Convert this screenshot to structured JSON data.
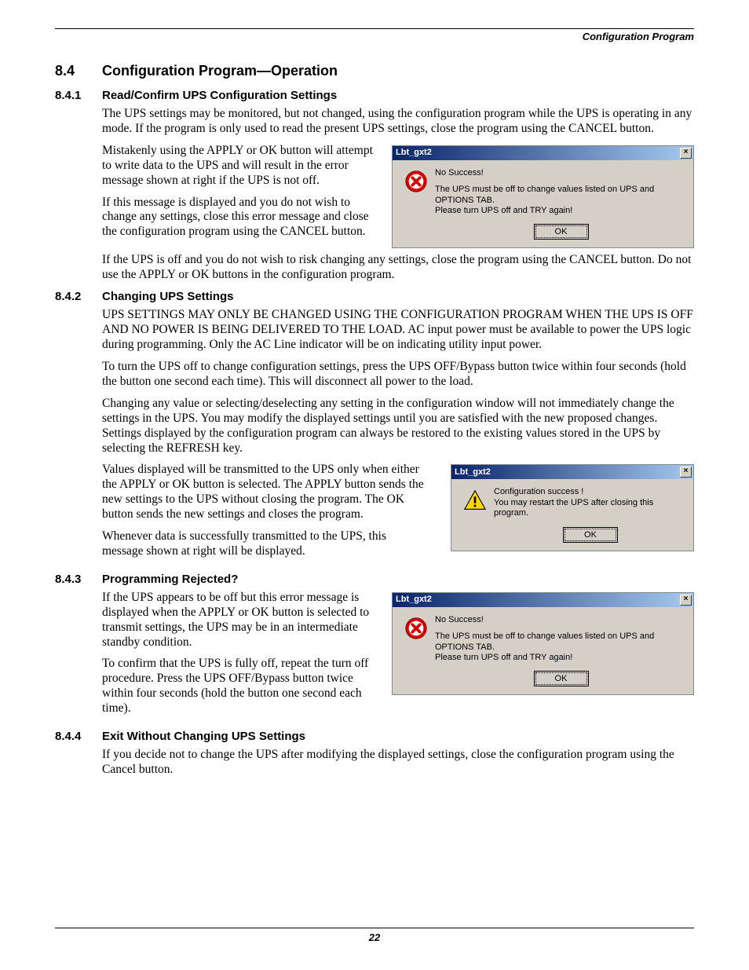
{
  "header": {
    "section": "Configuration Program"
  },
  "h2": {
    "num": "8.4",
    "title": "Configuration Program—Operation"
  },
  "s841": {
    "num": "8.4.1",
    "title": "Read/Confirm UPS Configuration Settings",
    "p1": "The UPS settings may be monitored, but not changed, using the configuration program while the UPS is operating in any mode. If the program is only used to read the present UPS settings, close the program using the CANCEL button.",
    "p2": "Mistakenly using the APPLY or OK button will attempt to write data to the UPS and will result in the error message shown at right if the UPS is not off.",
    "p3": "If this message is displayed and you do not wish to change any settings, close this error message and close the configuration program using the CANCEL button.",
    "p4": "If the UPS is off and you do not wish to risk changing any settings, close the program using the CANCEL button. Do not use the APPLY or OK buttons in the configuration program."
  },
  "s842": {
    "num": "8.4.2",
    "title": "Changing UPS Settings",
    "p1": "UPS SETTINGS MAY ONLY BE CHANGED USING THE CONFIGURATION PROGRAM WHEN THE UPS IS OFF AND NO POWER IS BEING DELIVERED TO THE LOAD. AC input power must be available to power the UPS logic during programming. Only the AC Line indicator will be on indicating utility input power.",
    "p2": "To turn the UPS off to change configuration settings, press the UPS OFF/Bypass button twice within four seconds (hold the button one second each time). This will disconnect all power to the load.",
    "p3": "Changing any value or selecting/deselecting any setting in the configuration window will not immediately change the settings in the UPS. You may modify the displayed settings until you are satisfied with the new proposed changes. Settings displayed by the configuration program can always be restored to the existing values stored in the UPS by selecting the REFRESH key.",
    "p4": "Values displayed will be transmitted to the UPS only when either the APPLY or OK button is selected. The APPLY button sends the new settings to the UPS without closing the program. The OK button sends the new settings and closes the program.",
    "p5": "Whenever data is successfully transmitted to the UPS, this message shown at right will be displayed."
  },
  "s843": {
    "num": "8.4.3",
    "title": "Programming Rejected?",
    "p1": "If the UPS appears to be off but this error message is displayed when the APPLY or OK button is selected to transmit settings, the UPS may be in an intermediate standby condition.",
    "p2": "To confirm that the UPS is fully off, repeat the turn off procedure. Press the UPS OFF/Bypass button twice within four seconds (hold the button one second each time)."
  },
  "s844": {
    "num": "8.4.4",
    "title": "Exit Without Changing UPS Settings",
    "p1": "If you decide not to change the UPS after modifying the displayed settings, close the configuration program using the Cancel button."
  },
  "dlg_err": {
    "title": "Lbt_gxt2",
    "l1": "No Success!",
    "l2": "The UPS must be off to change values listed on UPS and OPTIONS TAB.",
    "l3": "Please turn UPS off and TRY again!",
    "ok": "OK"
  },
  "dlg_ok": {
    "title": "Lbt_gxt2",
    "l1": "Configuration success !",
    "l2": "You may restart the UPS after closing this program.",
    "ok": "OK"
  },
  "footer": {
    "page": "22"
  }
}
